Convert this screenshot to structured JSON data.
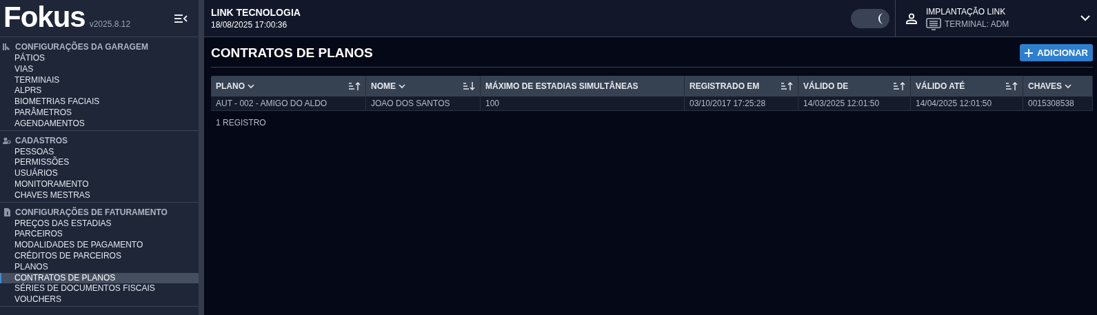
{
  "brand": {
    "logo": "Fokus",
    "version": "v2025.8.12"
  },
  "header": {
    "company": "LINK TECNOLOGIA",
    "datetime": "18/08/2025 17:00:36",
    "dark_mode": true,
    "user": "IMPLANTAÇÃO LINK",
    "terminal": "TERMINAL: ADM"
  },
  "sidebar": {
    "groups": [
      {
        "title": "CONFIGURAÇÕES DA GARAGEM",
        "kind": "garage",
        "items": [
          {
            "label": "PÁTIOS",
            "selected": false
          },
          {
            "label": "VIAS",
            "selected": false
          },
          {
            "label": "TERMINAIS",
            "selected": false
          },
          {
            "label": "ALPRS",
            "selected": false
          },
          {
            "label": "BIOMETRIAS FACIAIS",
            "selected": false
          },
          {
            "label": "PARÂMETROS",
            "selected": false
          },
          {
            "label": "AGENDAMENTOS",
            "selected": false
          }
        ]
      },
      {
        "title": "CADASTROS",
        "kind": "people",
        "items": [
          {
            "label": "PESSOAS",
            "selected": false
          },
          {
            "label": "PERMISSÕES",
            "selected": false
          },
          {
            "label": "USUÁRIOS",
            "selected": false
          },
          {
            "label": "MONITORAMENTO",
            "selected": false
          },
          {
            "label": "CHAVES MESTRAS",
            "selected": false
          }
        ]
      },
      {
        "title": "CONFIGURAÇÕES DE FATURAMENTO",
        "kind": "billing",
        "items": [
          {
            "label": "PREÇOS DAS ESTADIAS",
            "selected": false
          },
          {
            "label": "PARCEIROS",
            "selected": false
          },
          {
            "label": "MODALIDADES DE PAGAMENTO",
            "selected": false
          },
          {
            "label": "CRÉDITOS DE PARCEIROS",
            "selected": false
          },
          {
            "label": "PLANOS",
            "selected": false
          },
          {
            "label": "CONTRATOS DE PLANOS",
            "selected": true
          },
          {
            "label": "SÉRIES DE DOCUMENTOS FISCAIS",
            "selected": false
          },
          {
            "label": "VOUCHERS",
            "selected": false
          }
        ]
      }
    ]
  },
  "page": {
    "title": "CONTRATOS DE PLANOS",
    "add_button": "ADICIONAR"
  },
  "table": {
    "columns": [
      {
        "label": "PLANO",
        "filter": true,
        "sortable": true,
        "descending": false
      },
      {
        "label": "NOME",
        "filter": true,
        "sortable": true,
        "descending": true
      },
      {
        "label": "MÁXIMO DE ESTADIAS SIMULTÂNEAS",
        "filter": false,
        "sortable": false
      },
      {
        "label": "REGISTRADO EM",
        "filter": false,
        "sortable": true,
        "descending": false
      },
      {
        "label": "VÁLIDO DE",
        "filter": false,
        "sortable": true,
        "descending": false
      },
      {
        "label": "VÁLIDO ATÉ",
        "filter": false,
        "sortable": true,
        "descending": false
      },
      {
        "label": "CHAVES",
        "filter": true,
        "sortable": false
      }
    ],
    "rows": [
      [
        "AUT - 002 - AMIGO DO ALDO",
        "JOAO DOS SANTOS",
        "100",
        "03/10/2017 17:25:28",
        "14/03/2025 12:01:50",
        "14/04/2025 12:01:50",
        "0015308538"
      ]
    ],
    "count": "1 REGISTRO"
  }
}
